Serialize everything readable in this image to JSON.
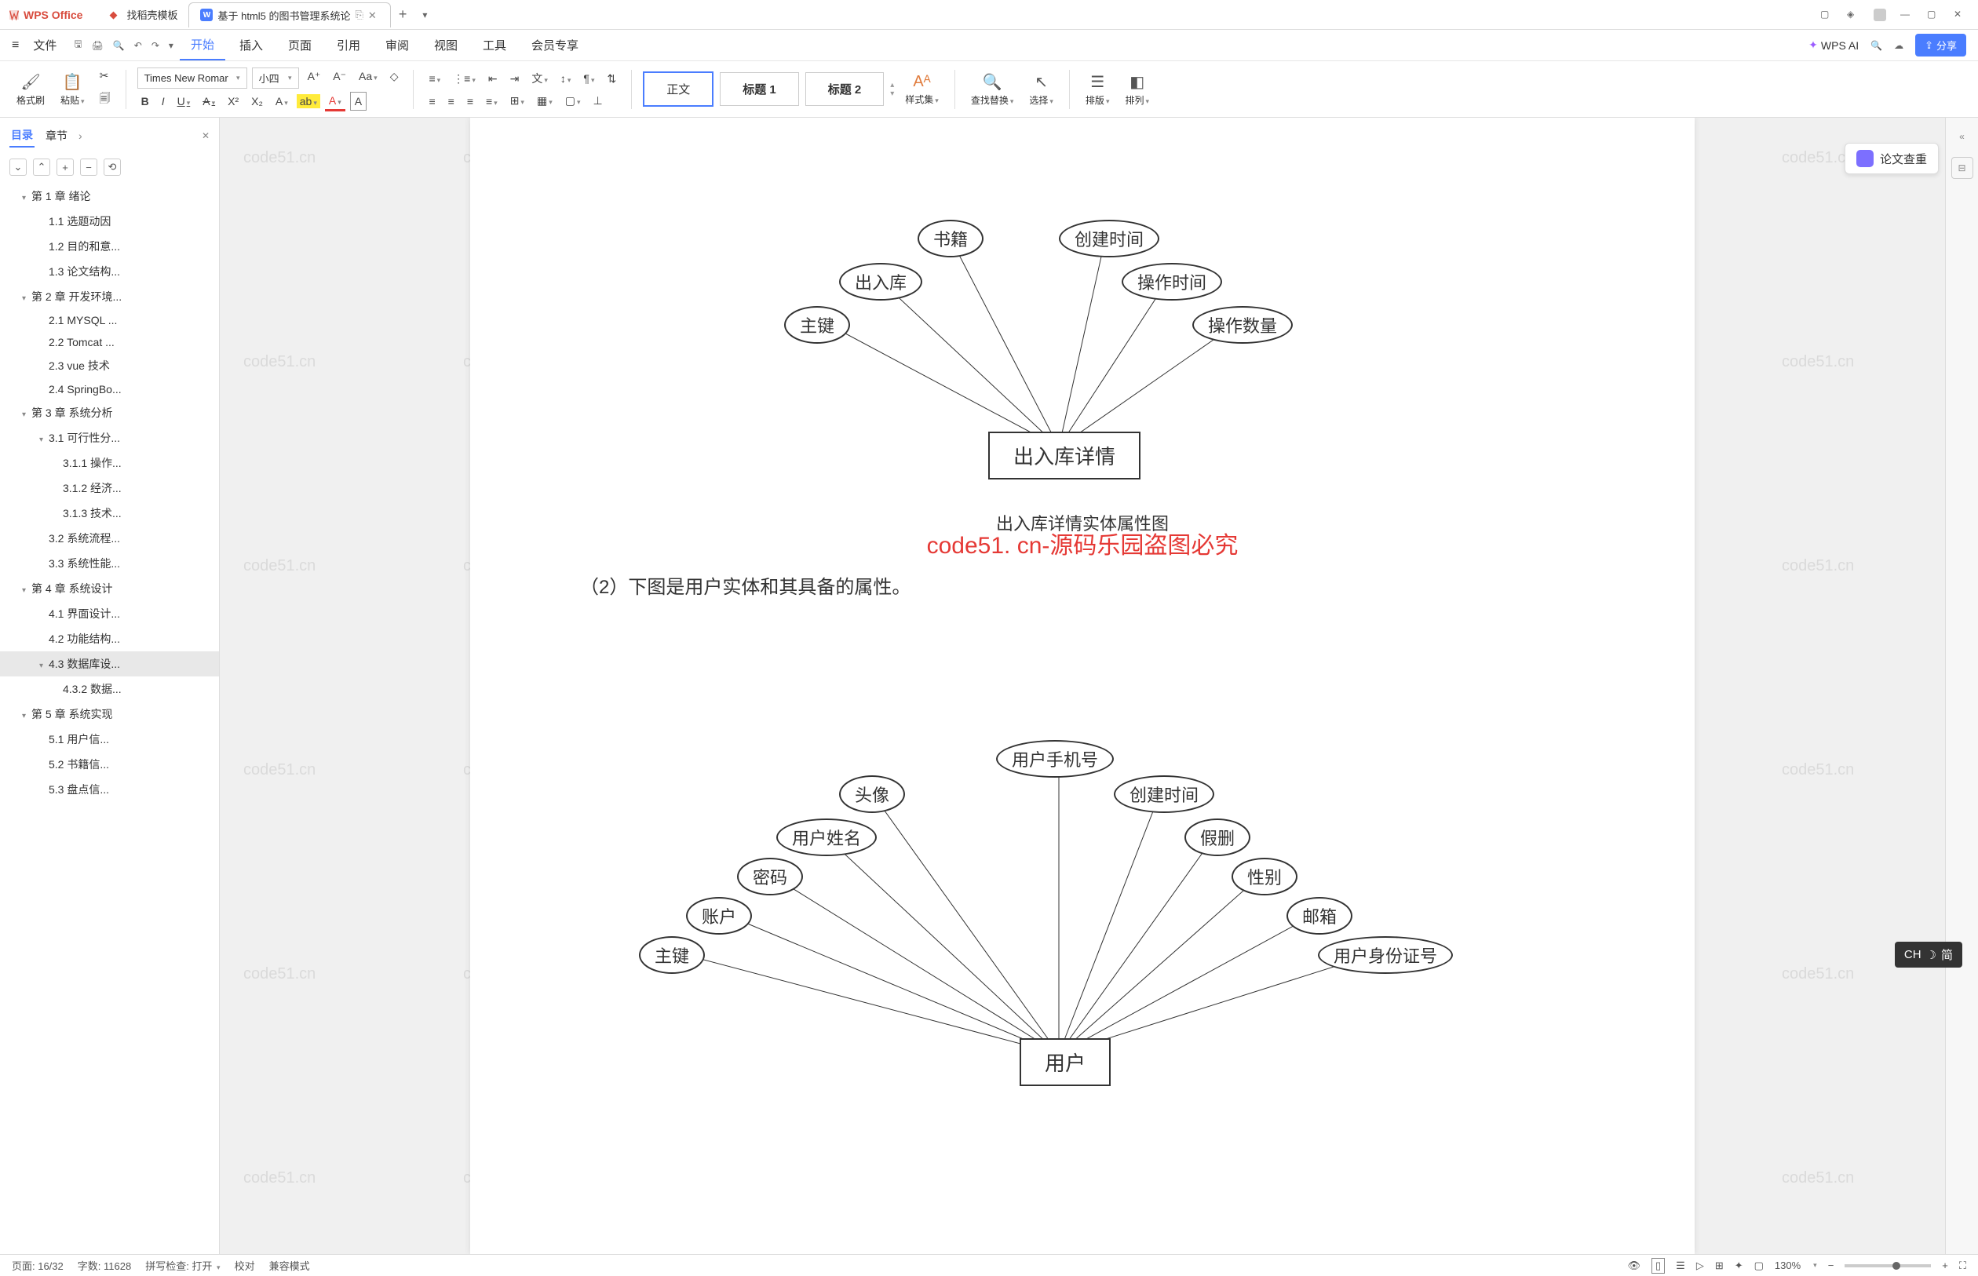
{
  "titleBar": {
    "appName": "WPS Office",
    "tabs": [
      {
        "label": "找稻壳模板",
        "type": "d"
      },
      {
        "label": "基于 html5 的图书管理系统论",
        "type": "w",
        "active": true
      }
    ]
  },
  "menuBar": {
    "fileLabel": "文件",
    "items": [
      "开始",
      "插入",
      "页面",
      "引用",
      "审阅",
      "视图",
      "工具",
      "会员专享"
    ],
    "activeIndex": 0,
    "wpsAi": "WPS AI",
    "shareLabel": "分享"
  },
  "toolbar": {
    "formatBrush": "格式刷",
    "paste": "粘贴",
    "font": "Times New Romar",
    "fontSize": "小四",
    "styles": {
      "normal": "正文",
      "h1": "标题 1",
      "h2": "标题 2"
    },
    "styleSet": "样式集",
    "findReplace": "查找替换",
    "select": "选择",
    "sort": "排版",
    "arrange": "排列"
  },
  "outline": {
    "tabDirectory": "目录",
    "tabChapter": "章节",
    "items": [
      {
        "t": "第 1 章 绪论",
        "l": 1,
        "c": true
      },
      {
        "t": "1.1 选题动因",
        "l": 2
      },
      {
        "t": "1.2 目的和意...",
        "l": 2
      },
      {
        "t": "1.3 论文结构...",
        "l": 2
      },
      {
        "t": "第 2 章 开发环境...",
        "l": 1,
        "c": true
      },
      {
        "t": "2.1 MYSQL ...",
        "l": 2
      },
      {
        "t": "2.2 Tomcat ...",
        "l": 2
      },
      {
        "t": "2.3 vue 技术",
        "l": 2
      },
      {
        "t": "2.4 SpringBo...",
        "l": 2
      },
      {
        "t": "第 3 章 系统分析",
        "l": 1,
        "c": true
      },
      {
        "t": "3.1 可行性分...",
        "l": 2,
        "c": true
      },
      {
        "t": "3.1.1 操作...",
        "l": 3
      },
      {
        "t": "3.1.2 经济...",
        "l": 3
      },
      {
        "t": "3.1.3 技术...",
        "l": 3
      },
      {
        "t": "3.2 系统流程...",
        "l": 2
      },
      {
        "t": "3.3 系统性能...",
        "l": 2
      },
      {
        "t": "第 4 章 系统设计",
        "l": 1,
        "c": true
      },
      {
        "t": "4.1 界面设计...",
        "l": 2
      },
      {
        "t": "4.2 功能结构...",
        "l": 2
      },
      {
        "t": "4.3 数据库设...",
        "l": 2,
        "c": true,
        "sel": true
      },
      {
        "t": "4.3.2 数据...",
        "l": 3
      },
      {
        "t": "第 5 章 系统实现",
        "l": 1,
        "c": true
      },
      {
        "t": "5.1 用户信...",
        "l": 2
      },
      {
        "t": "5.2 书籍信...",
        "l": 2
      },
      {
        "t": "5.3 盘点信...",
        "l": 2
      }
    ]
  },
  "document": {
    "watermarkText": "code51.cn",
    "redOverlay": "code51. cn-源码乐园盗图必究",
    "diagram1": {
      "entity": "出入库详情",
      "caption": "出入库详情实体属性图",
      "attrs": [
        "主键",
        "出入库",
        "书籍",
        "创建时间",
        "操作时间",
        "操作数量"
      ]
    },
    "bodyText": "（2）下图是用户实体和其具备的属性。",
    "diagram2": {
      "entity": "用户",
      "attrs": [
        "主键",
        "账户",
        "密码",
        "用户姓名",
        "头像",
        "用户手机号",
        "创建时间",
        "假删",
        "性别",
        "邮箱",
        "用户身份证号"
      ]
    }
  },
  "rightPanel": {
    "lunwen": "论文查重"
  },
  "statusBar": {
    "page": "页面: 16/32",
    "wordCount": "字数: 11628",
    "spellCheck": "拼写检查: 打开",
    "proof": "校对",
    "compat": "兼容模式",
    "zoom": "130%"
  },
  "ime": {
    "lang": "CH",
    "mode": "简"
  }
}
